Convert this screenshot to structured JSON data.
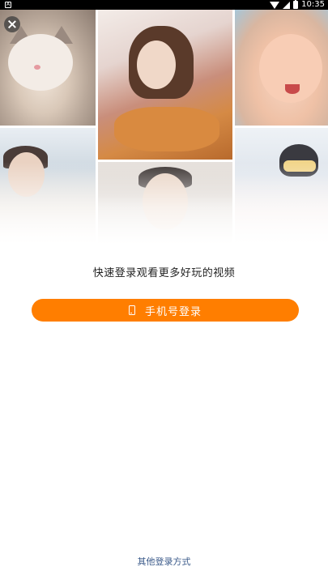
{
  "status_bar": {
    "notification_icon": "notification-a-icon",
    "notification_label": "A",
    "time": "10:35",
    "icons": [
      "wifi-icon",
      "signal-icon",
      "battery-icon"
    ]
  },
  "collage": {
    "tiles": [
      "cat-photo",
      "woman-photo",
      "baby-photo",
      "man-photo",
      "man-photo-2",
      "skier-photo"
    ]
  },
  "close_button": {
    "icon": "close-icon"
  },
  "login": {
    "tagline": "快速登录观看更多好玩的视频",
    "phone_button_label": "手机号登录",
    "phone_button_icon": "phone-icon",
    "other_login_label": "其他登录方式"
  },
  "colors": {
    "accent": "#ff7e00",
    "link": "#3b5a8a",
    "text": "#222222"
  }
}
